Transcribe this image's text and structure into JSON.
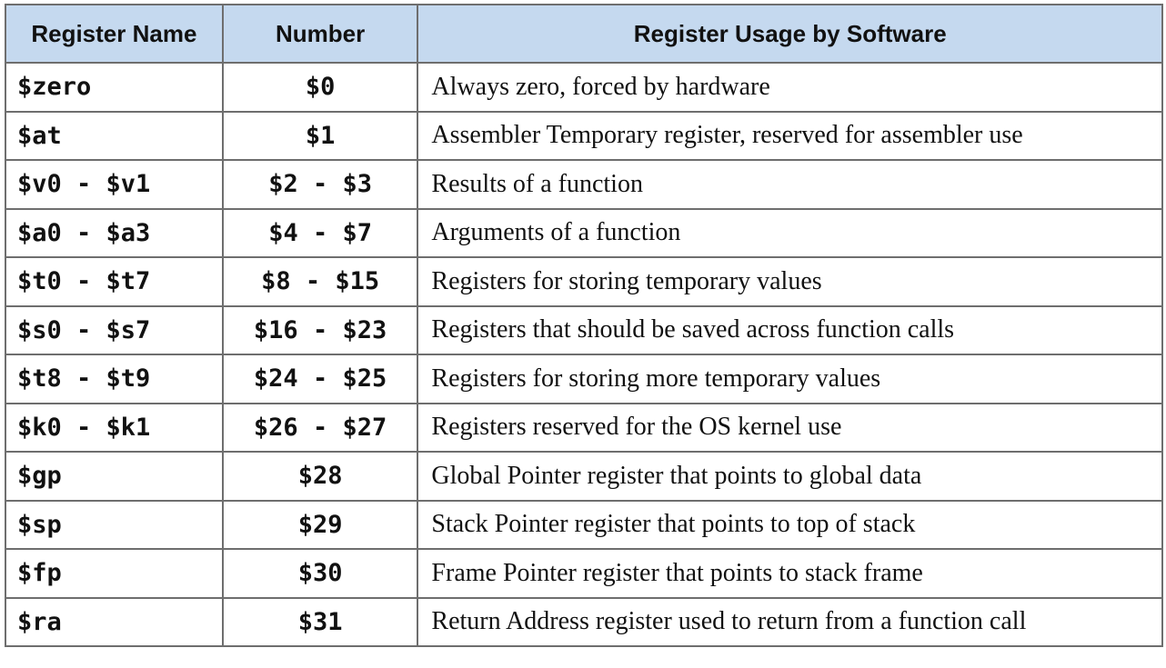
{
  "table": {
    "headers": [
      "Register Name",
      "Number",
      "Register Usage by Software"
    ],
    "header_bg": "#c5d9ef",
    "rows": [
      {
        "name": "$zero",
        "number": "$0",
        "usage": "Always zero, forced by hardware"
      },
      {
        "name": "$at",
        "number": "$1",
        "usage": "Assembler Temporary register, reserved for assembler use"
      },
      {
        "name": "$v0 - $v1",
        "number": "$2 - $3",
        "usage": "Results of a function"
      },
      {
        "name": "$a0 - $a3",
        "number": "$4 - $7",
        "usage": "Arguments of a function"
      },
      {
        "name": "$t0 - $t7",
        "number": "$8 - $15",
        "usage": "Registers for storing temporary values"
      },
      {
        "name": "$s0 - $s7",
        "number": "$16 - $23",
        "usage": "Registers that should be saved across function calls"
      },
      {
        "name": "$t8 - $t9",
        "number": "$24 - $25",
        "usage": "Registers for storing more temporary values"
      },
      {
        "name": "$k0 - $k1",
        "number": "$26 - $27",
        "usage": "Registers reserved for the OS kernel use"
      },
      {
        "name": "$gp",
        "number": "$28",
        "usage": "Global Pointer register that points to global data"
      },
      {
        "name": "$sp",
        "number": "$29",
        "usage": "Stack Pointer register that points to top of stack"
      },
      {
        "name": "$fp",
        "number": "$30",
        "usage": "Frame Pointer register that points to stack frame"
      },
      {
        "name": "$ra",
        "number": "$31",
        "usage": "Return Address register used to return from a function call"
      }
    ]
  }
}
